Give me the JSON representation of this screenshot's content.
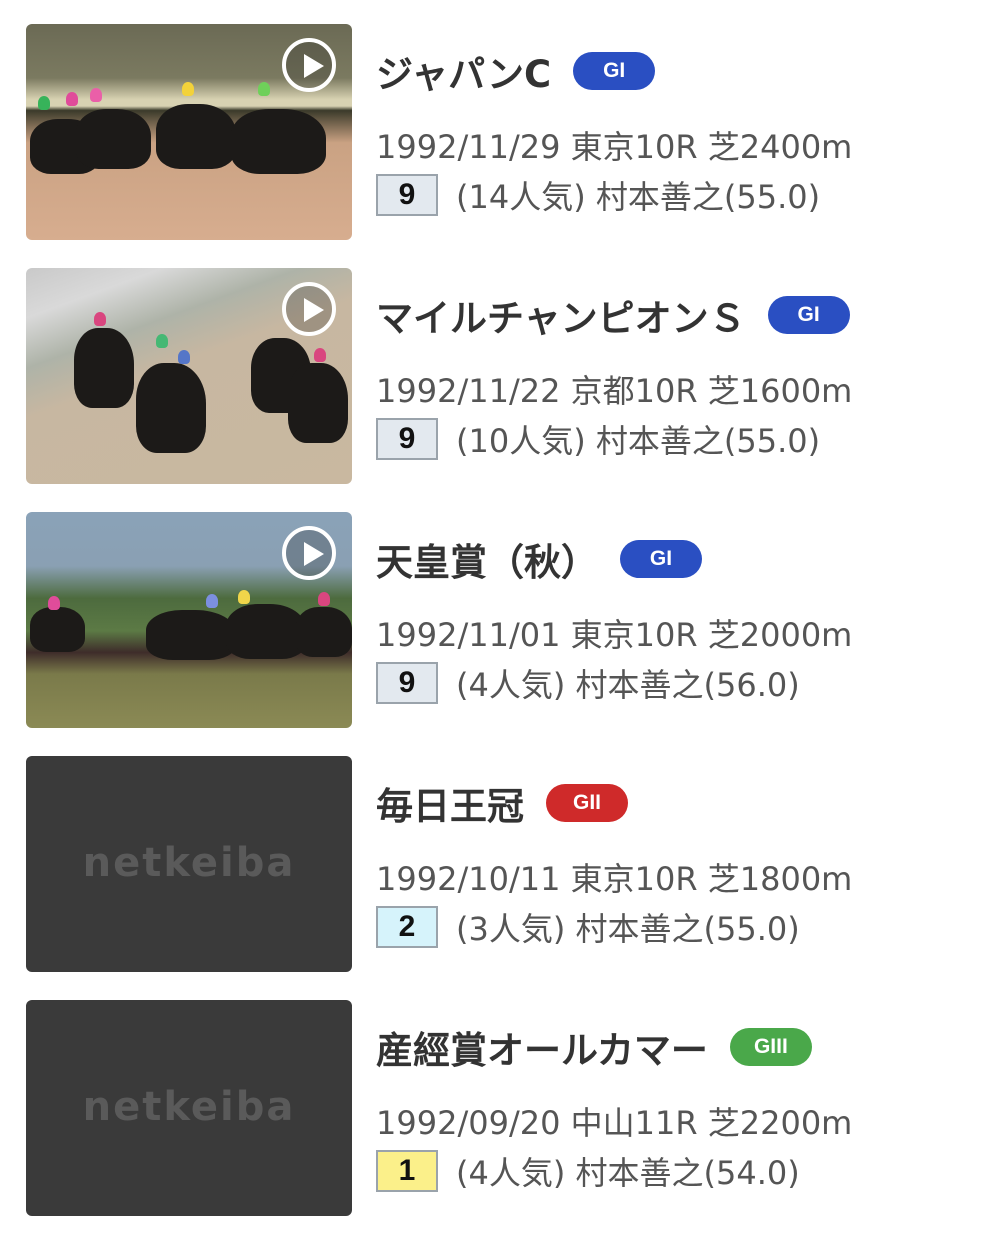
{
  "races": [
    {
      "name": "ジャパンC",
      "grade": "GI",
      "grade_color": "#2a4fc2",
      "meta": "1992/11/29 東京10R 芝2400m",
      "finish": "9",
      "finish_bg": "#e3e9ef",
      "result": "(14人気) 村本善之(55.0)",
      "thumbnail": "video",
      "thumbnail_icon": "play-icon"
    },
    {
      "name": "マイルチャンピオンＳ",
      "grade": "GI",
      "grade_color": "#2a4fc2",
      "meta": "1992/11/22 京都10R 芝1600m",
      "finish": "9",
      "finish_bg": "#e3e9ef",
      "result": "(10人気) 村本善之(55.0)",
      "thumbnail": "video",
      "thumbnail_icon": "play-icon"
    },
    {
      "name": "天皇賞（秋）",
      "grade": "GI",
      "grade_color": "#2a4fc2",
      "meta": "1992/11/01 東京10R 芝2000m",
      "finish": "9",
      "finish_bg": "#e3e9ef",
      "result": "(4人気) 村本善之(56.0)",
      "thumbnail": "video",
      "thumbnail_icon": "play-icon"
    },
    {
      "name": "毎日王冠",
      "grade": "GII",
      "grade_color": "#cf2a2a",
      "meta": "1992/10/11 東京10R 芝1800m",
      "finish": "2",
      "finish_bg": "#d6f3fb",
      "result": "(3人気) 村本善之(55.0)",
      "thumbnail": "placeholder",
      "placeholder_logo": "netkeiba"
    },
    {
      "name": "産經賞オールカマー",
      "grade": "GIII",
      "grade_color": "#4aa84a",
      "meta": "1992/09/20 中山11R 芝2200m",
      "finish": "1",
      "finish_bg": "#fbf08a",
      "result": "(4人気) 村本善之(54.0)",
      "thumbnail": "placeholder",
      "placeholder_logo": "netkeiba"
    }
  ]
}
